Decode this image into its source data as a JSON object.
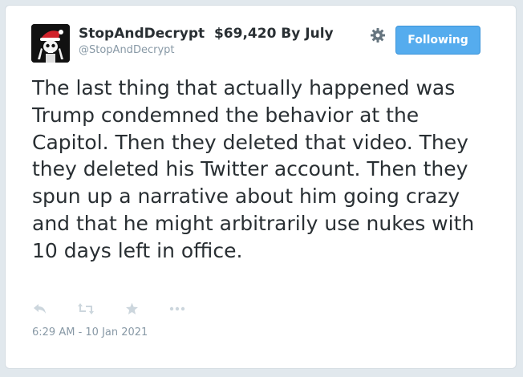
{
  "tweet": {
    "author": {
      "display_name": "StopAndDecrypt  $69,420 By July",
      "handle": "@StopAndDecrypt",
      "avatar_icon": "skeleton-santa-avatar"
    },
    "follow_button_label": "Following",
    "text": "The last thing that actually happened was Trump condemned the behavior at the Capitol. Then they deleted that video. They they deleted his Twitter account. Then they spun up a narrative about him going crazy and that he might arbitrarily use nukes with 10 days left in office.",
    "actions": [
      {
        "name": "reply-icon"
      },
      {
        "name": "retweet-icon"
      },
      {
        "name": "like-star-icon"
      },
      {
        "name": "more-icon"
      }
    ],
    "timestamp": "6:29 AM - 10 Jan 2021"
  },
  "colors": {
    "accent": "#55acee",
    "text": "#292f33",
    "muted": "#8899a6",
    "icon": "#ccd6dd"
  }
}
